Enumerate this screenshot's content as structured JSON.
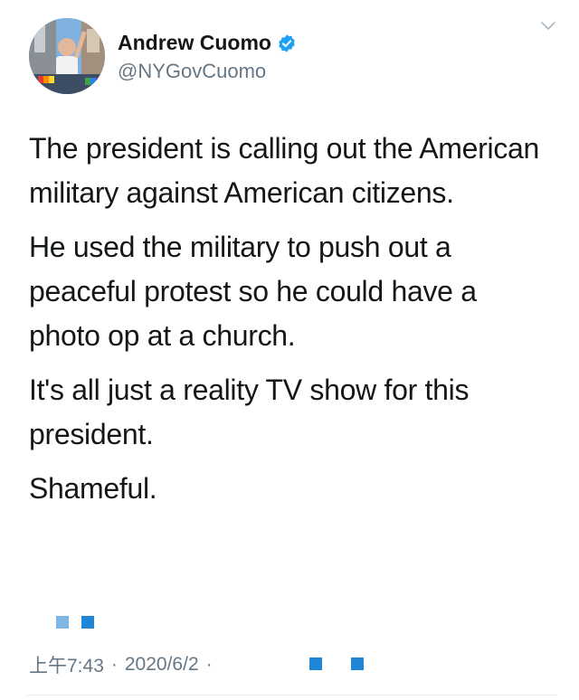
{
  "author": {
    "name": "Andrew Cuomo",
    "handle": "@NYGovCuomo",
    "verified": true,
    "avatar_icon": "profile-photo"
  },
  "menu_icon": "chevron-down-icon",
  "tweet": {
    "paragraphs": [
      "The president is calling out the American military against American citizens.",
      "He used the military to push out a peaceful protest so he could have a photo op at a church.",
      "It's all just a reality TV show for this president.",
      "Shameful."
    ]
  },
  "meta": {
    "time": "上午7:43",
    "separator": "·",
    "date": "2020/6/2",
    "trailing_separator": "·"
  },
  "colors": {
    "text": "#14171a",
    "secondary": "#657786",
    "accent": "#1da1f2"
  }
}
